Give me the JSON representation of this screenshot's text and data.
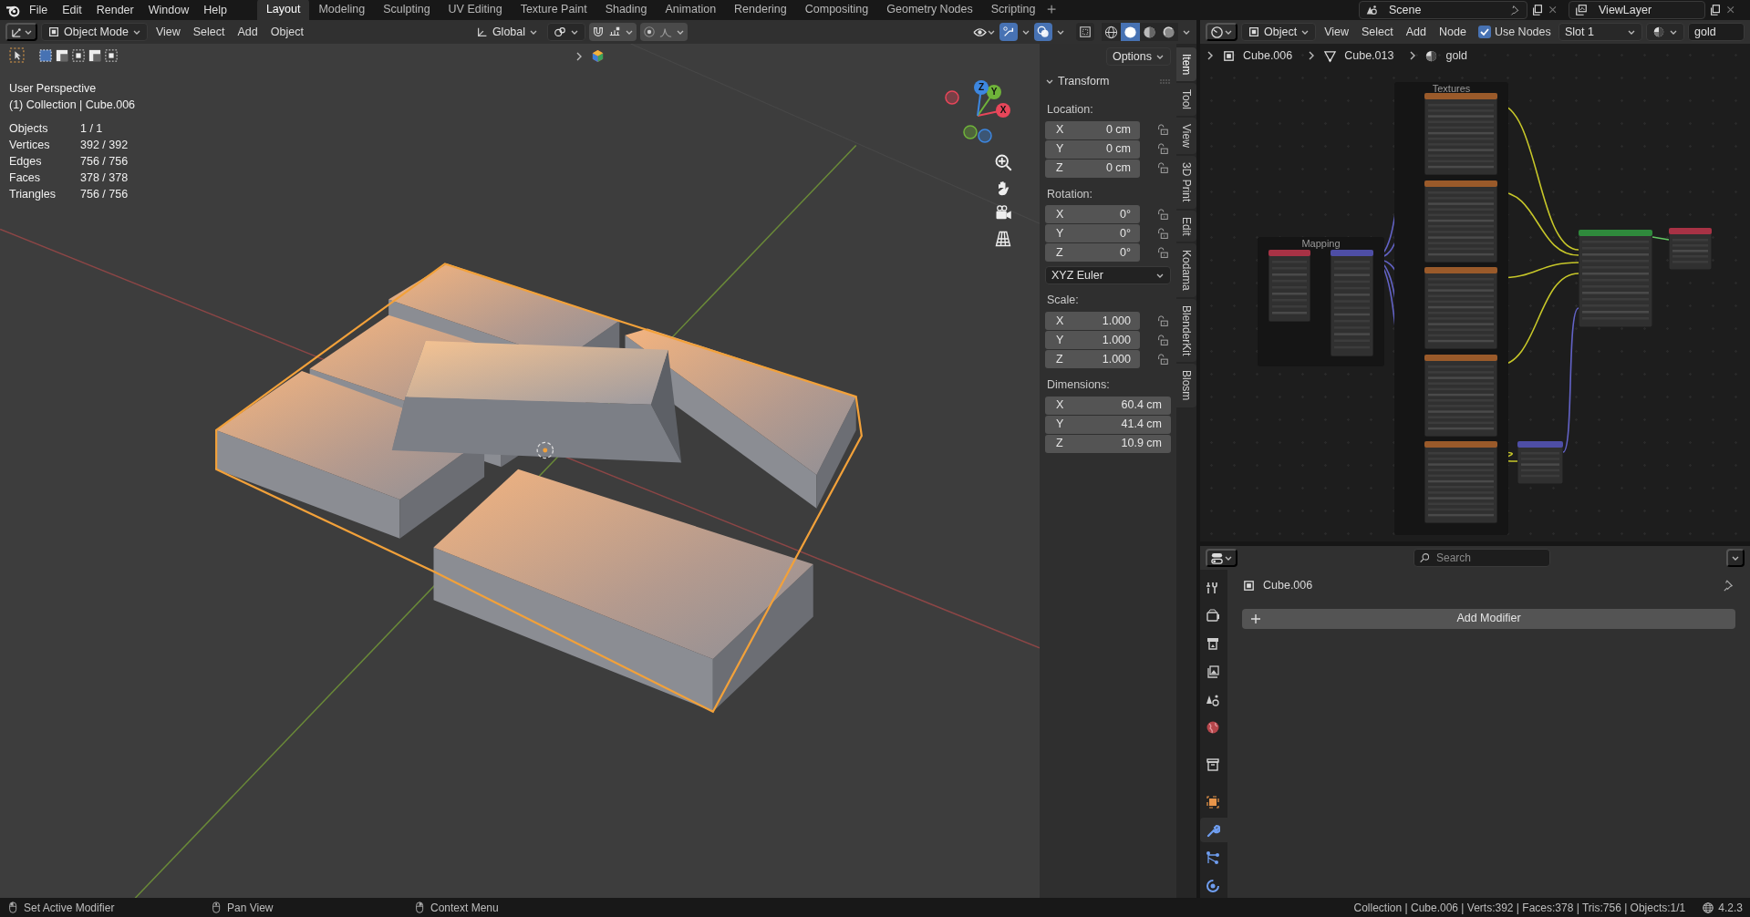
{
  "topbar": {
    "menus": [
      "File",
      "Edit",
      "Render",
      "Window",
      "Help"
    ],
    "workspaces": [
      {
        "label": "Layout",
        "selected": true
      },
      {
        "label": "Modeling",
        "selected": false
      },
      {
        "label": "Sculpting",
        "selected": false
      },
      {
        "label": "UV Editing",
        "selected": false
      },
      {
        "label": "Texture Paint",
        "selected": false
      },
      {
        "label": "Shading",
        "selected": false
      },
      {
        "label": "Animation",
        "selected": false
      },
      {
        "label": "Rendering",
        "selected": false
      },
      {
        "label": "Compositing",
        "selected": false
      },
      {
        "label": "Geometry Nodes",
        "selected": false
      },
      {
        "label": "Scripting",
        "selected": false
      }
    ],
    "scene": "Scene",
    "view_layer": "ViewLayer"
  },
  "viewport": {
    "mode": "Object Mode",
    "menus": [
      "View",
      "Select",
      "Add",
      "Object"
    ],
    "orientation": "Global",
    "snapping": {
      "on": false
    },
    "proportional_editing": {
      "on": false
    },
    "shading": [
      {
        "kind": "wireframe",
        "selected": false
      },
      {
        "kind": "solid",
        "selected": true
      },
      {
        "kind": "material",
        "selected": false
      },
      {
        "kind": "rendered",
        "selected": false
      }
    ],
    "overlay_text": [
      "User Perspective",
      "(1) Collection | Cube.006"
    ],
    "stats": [
      {
        "label": "Objects",
        "value": "1 / 1"
      },
      {
        "label": "Vertices",
        "value": "392 / 392"
      },
      {
        "label": "Edges",
        "value": "756 / 756"
      },
      {
        "label": "Faces",
        "value": "378 / 378"
      },
      {
        "label": "Triangles",
        "value": "756 / 756"
      }
    ],
    "gizmo_axes": [
      "X",
      "Y",
      "Z"
    ]
  },
  "sidebar": {
    "options": "Options",
    "panel": "Transform",
    "expanded": true,
    "items": [
      {
        "kind": "group",
        "label": "Location:",
        "fields": [
          {
            "axis": "X",
            "value": "0 cm",
            "locked": false
          },
          {
            "axis": "Y",
            "value": "0 cm",
            "locked": false
          },
          {
            "axis": "Z",
            "value": "0 cm",
            "locked": false
          }
        ]
      },
      {
        "kind": "group",
        "label": "Rotation:",
        "fields": [
          {
            "axis": "X",
            "value": "0°",
            "locked": false
          },
          {
            "axis": "Y",
            "value": "0°",
            "locked": false
          },
          {
            "axis": "Z",
            "value": "0°",
            "locked": false
          }
        ]
      },
      {
        "kind": "dropdown",
        "value": "XYZ Euler"
      },
      {
        "kind": "group",
        "label": "Scale:",
        "fields": [
          {
            "axis": "X",
            "value": "1.000",
            "locked": false
          },
          {
            "axis": "Y",
            "value": "1.000",
            "locked": false
          },
          {
            "axis": "Z",
            "value": "1.000",
            "locked": false
          }
        ]
      },
      {
        "kind": "group",
        "label": "Dimensions:",
        "fields": [
          {
            "axis": "X",
            "value": "60.4 cm"
          },
          {
            "axis": "Y",
            "value": "41.4 cm"
          },
          {
            "axis": "Z",
            "value": "10.9 cm"
          }
        ]
      }
    ],
    "tabs": [
      {
        "label": "Item",
        "selected": true
      },
      {
        "label": "Tool",
        "selected": false
      },
      {
        "label": "View",
        "selected": false
      },
      {
        "label": "3D Print",
        "selected": false
      },
      {
        "label": "Edit",
        "selected": false
      },
      {
        "label": "Kodama",
        "selected": false
      },
      {
        "label": "BlenderKit",
        "selected": false
      },
      {
        "label": "Blosm",
        "selected": false
      }
    ]
  },
  "node_editor": {
    "object_type": "Object",
    "menus": [
      "View",
      "Select",
      "Add",
      "Node"
    ],
    "use_nodes": {
      "label": "Use Nodes",
      "checked": true
    },
    "slot": "Slot 1",
    "material": "gold",
    "breadcrumbs": [
      {
        "kind": "object",
        "label": "Cube.006"
      },
      {
        "kind": "mesh",
        "label": "Cube.013"
      },
      {
        "kind": "material",
        "label": "gold"
      }
    ],
    "frames": [
      "Mapping",
      "Textures"
    ]
  },
  "properties": {
    "search": {
      "placeholder": "Search"
    },
    "object": "Cube.006",
    "add_modifier": "Add Modifier",
    "tabs": [
      {
        "kind": "tool",
        "selected": false
      },
      {
        "kind": "render",
        "selected": false
      },
      {
        "kind": "output",
        "selected": false
      },
      {
        "kind": "view_layer",
        "selected": false
      },
      {
        "kind": "scene",
        "selected": false
      },
      {
        "kind": "world",
        "selected": false
      },
      {
        "kind": "collection",
        "selected": false
      },
      {
        "kind": "object",
        "selected": false
      },
      {
        "kind": "modifiers",
        "selected": true
      },
      {
        "kind": "particles",
        "selected": false
      },
      {
        "kind": "physics",
        "selected": false
      }
    ]
  },
  "status_bar": {
    "hints": [
      "Set Active Modifier",
      "Pan View",
      "Context Menu"
    ],
    "stats": "Collection | Cube.006 | Verts:392 | Faces:378 | Tris:756 | Objects:1/1",
    "version": "4.2.3"
  }
}
